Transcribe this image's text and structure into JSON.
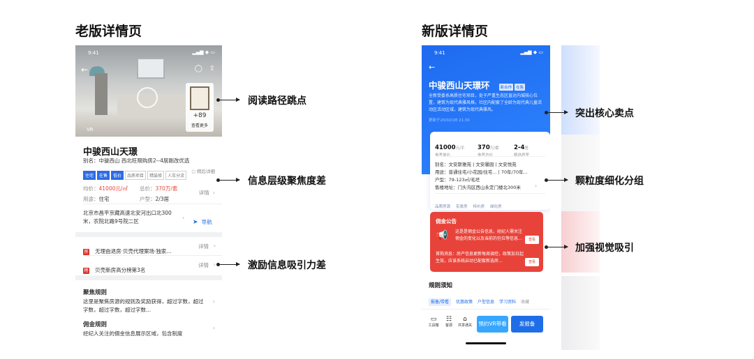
{
  "headings": {
    "old": "老版详情页",
    "new": "新版详情页"
  },
  "callouts_left": [
    "阅读路径跳点",
    "信息层级聚焦度差",
    "激励信息吸引力差"
  ],
  "callouts_right": [
    "突出核心卖点",
    "颗粒度细化分组",
    "加强视觉吸引"
  ],
  "old_page": {
    "status_time": "9:41",
    "vr": "VR",
    "thumb_count": "+89",
    "thumb_label": "查看更多",
    "title": "中骏西山天璟",
    "alias": "别名：中骏西山  西北旺限购房2--4居刚改优选",
    "tags": [
      "住宅",
      "在售",
      "低价",
      "品质项目",
      "精装修",
      "人车分流"
    ],
    "tag_right": "○ 稍后详细",
    "price_label": "均价：",
    "price_value": "41000元/㎡",
    "total_label": "总价：",
    "total_value": "370万/套",
    "use_label": "用途：",
    "use_value": "住宅",
    "type_label": "户型：",
    "type_value": "2/3居",
    "detail": "详情",
    "address": "北京市昌平京藏高速北安河出口北300米，农院北路9号院二区",
    "nav": "导航",
    "incentive1": "无理由退房·贝壳代理案场·独家...",
    "incentive2": "贝壳新房高分榜第3名",
    "rule_title": "聚焦规则",
    "rule_text": "这里是聚焦房源的规则及奖励获得，超过字数，超过字数，超过字数，超过字数...",
    "commission_title": "佣金规则",
    "commission_text": "经纪人关注的佣金信息展示区域，包含制度"
  },
  "new_page": {
    "status_time": "9:41",
    "title": "中骏西山天璟环",
    "tags": [
      "新合作",
      "在售"
    ],
    "desc": "全新受委系高质住宅项目，处于严重生态区直达内城核心位置，建筑为现代典雅风格，社区内配套了全龄为现代典儿童活动区活动区域，建筑为现代典雅风。",
    "update": "更新于20/02/28 21:30",
    "stats": [
      {
        "value": "41000",
        "unit": "元/平",
        "label": "参考单价"
      },
      {
        "value": "370",
        "unit": "万/套",
        "label": "参考总价"
      },
      {
        "value": "2-4",
        "unit": "居",
        "label": "精选居室"
      }
    ],
    "info": [
      "别名：文安斯雅苑 | 文安馨园 | 文安悦苑",
      "用途：普通住宅/小花园/住宅... | 70年/70年...",
      "户型：79-123㎡/毛坯",
      "售楼地址：门头沟区西山永定门楼北300米"
    ],
    "features": [
      "品质房源",
      "实景房",
      "特价房",
      "绿化房"
    ],
    "notice_title": "佣金公告",
    "notice_text": "这是是佣金公告信息，经纪人需关注佣金的变化以及当前的包位等信息...",
    "notice_more": "查看",
    "notice_text2": "首购消息：房产信息更新每周调控，政策加日起生效，应该系统启动已配套新选房...",
    "notice_more2": "查看",
    "rules_title": "规则须知",
    "rule_tabs": [
      "报备/带看",
      "优惠政策",
      "户型信息",
      "学习资料",
      "收藏"
    ],
    "bottom_icons": [
      "工具箱",
      "客源",
      "共享通关"
    ],
    "btn_vr": "预约VR带看",
    "btn_report": "发报备"
  }
}
